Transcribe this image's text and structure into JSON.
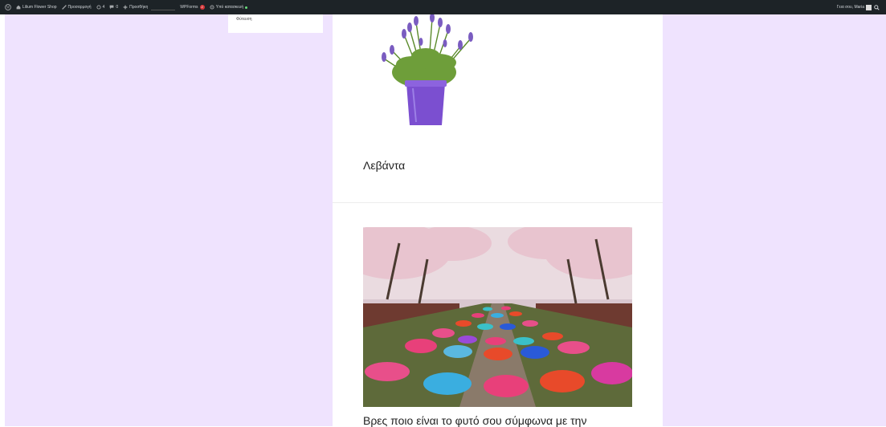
{
  "admin_bar": {
    "site_name": "Lilium Flower Shop",
    "customize_label": "Προσαρμογή",
    "updates_count": "4",
    "comments_count": "0",
    "new_label": "Προσθήκη",
    "wpforms_label": "WPForms",
    "wpforms_badge": "2",
    "optimize_label": "Υπό κατασκευή",
    "user_greeting": "Γεια σου, Maria"
  },
  "dropdown": {
    "item": "Φύτευση"
  },
  "posts": [
    {
      "title": "Λεβάντα",
      "image_icon": "lavender-pot-image"
    },
    {
      "title": "Βρες ποιο είναι το φυτό σου σύμφωνα με την",
      "image_icon": "umbrella-street-photo"
    }
  ],
  "colors": {
    "page_background": "#efe3fe",
    "admin_bar": "#1d2327",
    "pot_purple": "#7b4fd0"
  }
}
